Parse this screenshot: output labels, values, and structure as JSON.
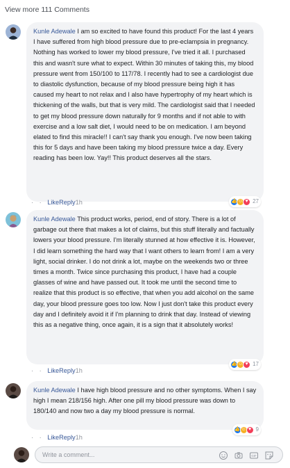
{
  "view_more": "View more 111 Comments",
  "comments": [
    {
      "author": "Kunle Adewale",
      "text": "I am so excited to have found this product! For the last 4 years I have suffered from high blood pressure due to pre-eclampsia in pregnancy. Nothing has worked to lower my blood pressure, I've tried it all. I purchased this and wasn't sure what to expect. Within 30 minutes of taking this, my blood pressure went from 150/100 to 117/78. I recently had to see a cardiologist due to diastolic dysfunction, because of my blood pressure being high it has caused my heart to not relax and I also have hypertrophy of my heart which is thickening of the walls, but that is very mild. The cardiologist said that I needed to get my blood pressure down naturally for 9 months and if not able to with exercise and a low salt diet, I would need to be on medication. I am beyond elated to find this miracle!! I can't say thank you enough. I've now been taking this for 5 days and have been taking my blood pressure twice a day. Every reading has been low. Yay!! This product deserves all the stars.",
      "reaction_count": "27",
      "like": "Like",
      "reply": "Reply",
      "time": "1h"
    },
    {
      "author": "Kunle Adewale",
      "text": "This product works, period, end of story. There is a lot of garbage out there that makes a lot of claims, but this stuff literally and factually lowers your blood pressure. I'm literally stunned at how effective it is. However, I did learn something the hard way that I want others to learn from! I am a very light, social drinker. I do not drink a lot, maybe on the weekends two or three times a month. Twice since purchasing this product, I have had a couple glasses of wine and have passed out. It took me until the second time to realize that this product is so effective, that when you add alcohol on the same day, your blood pressure goes too low. Now I just don't take this product every day and I definitely avoid it if I'm planning to drink that day. Instead of viewing this as a negative thing, once again, it is a sign that it absolutely works!",
      "reaction_count": "17",
      "like": "Like",
      "reply": "Reply",
      "time": "1h"
    },
    {
      "author": "Kunle Adewale",
      "text": "I have high blood pressure and no other symptoms. When I say high I mean 218/156 high. After one pill my blood pressure was down to 180/140 and now two a day my blood pressure is normal.",
      "reaction_count": "9",
      "like": "Like",
      "reply": "Reply",
      "time": "1h"
    }
  ],
  "composer": {
    "placeholder": "Write a comment..."
  },
  "colors": {
    "author": "#385898",
    "bubble": "#f2f3f5",
    "like_reaction": "#1877f2",
    "haha_reaction": "#f7b125",
    "love_reaction": "#f33e58"
  },
  "icons": [
    "like-reaction-icon",
    "haha-reaction-icon",
    "love-reaction-icon",
    "emoji-icon",
    "camera-icon",
    "gif-icon",
    "sticker-icon"
  ]
}
